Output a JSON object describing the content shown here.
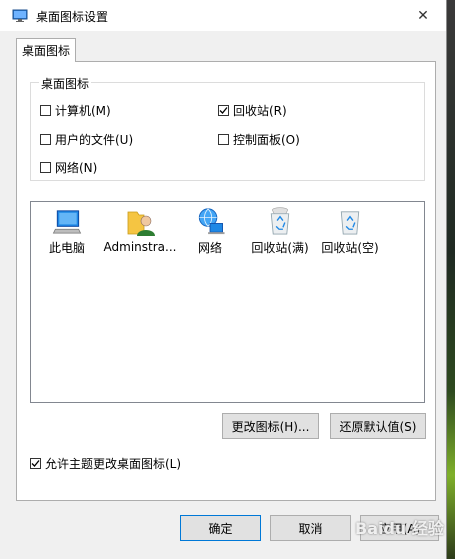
{
  "window": {
    "title": "桌面图标设置",
    "close_glyph": "✕"
  },
  "tabs": [
    {
      "label": "桌面图标"
    }
  ],
  "group": {
    "legend": "桌面图标",
    "checkboxes": [
      {
        "label": "计算机(M)",
        "checked": false
      },
      {
        "label": "回收站(R)",
        "checked": true
      },
      {
        "label": "用户的文件(U)",
        "checked": false
      },
      {
        "label": "控制面板(O)",
        "checked": false
      },
      {
        "label": "网络(N)",
        "checked": false
      }
    ]
  },
  "icons": [
    {
      "label": "此电脑",
      "icon": "computer-icon"
    },
    {
      "label": "Adminstra...",
      "icon": "user-folder-icon"
    },
    {
      "label": "网络",
      "icon": "network-icon"
    },
    {
      "label": "回收站(满)",
      "icon": "recycle-bin-full-icon"
    },
    {
      "label": "回收站(空)",
      "icon": "recycle-bin-empty-icon"
    }
  ],
  "buttons": {
    "change_icon": "更改图标(H)...",
    "restore_default": "还原默认值(S)",
    "ok": "确定",
    "cancel": "取消",
    "apply": "应用(A)"
  },
  "allow_themes": {
    "label": "允许主题更改桌面图标(L)",
    "checked": true
  },
  "watermark": "Baidu 经验",
  "colors": {
    "accent_border": "#0078d7",
    "checkmark": "#000000"
  }
}
